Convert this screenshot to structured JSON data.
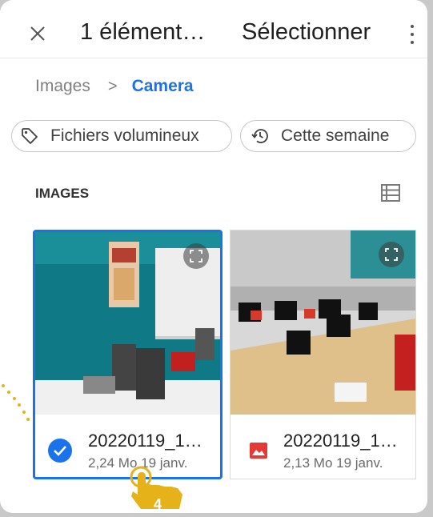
{
  "topbar": {
    "close_icon": "close-icon",
    "title": "1 élément…",
    "select_label": "Sélectionner",
    "more_icon": "more-vert-icon"
  },
  "breadcrumb": {
    "root": "Images",
    "separator": ">",
    "current": "Camera"
  },
  "filters": [
    {
      "label": "Fichiers volumineux",
      "icon": "tag-icon"
    },
    {
      "label": "Cette semaine",
      "icon": "history-icon"
    }
  ],
  "section": {
    "label": "IMAGES",
    "view_icon": "list-view-icon"
  },
  "files": [
    {
      "name": "20220119_1…",
      "meta": "2,24 Mo 19 janv.",
      "selected": true,
      "thumbnail": "coffee-corner-photo"
    },
    {
      "name": "20220119_1…",
      "meta": "2,13 Mo 19 janv.",
      "selected": false,
      "thumbnail": "office-desks-photo"
    }
  ],
  "callout": {
    "step": "4"
  },
  "colors": {
    "accent": "#1a73e8",
    "hand": "#e6b21a",
    "image_icon": "#e53935"
  }
}
